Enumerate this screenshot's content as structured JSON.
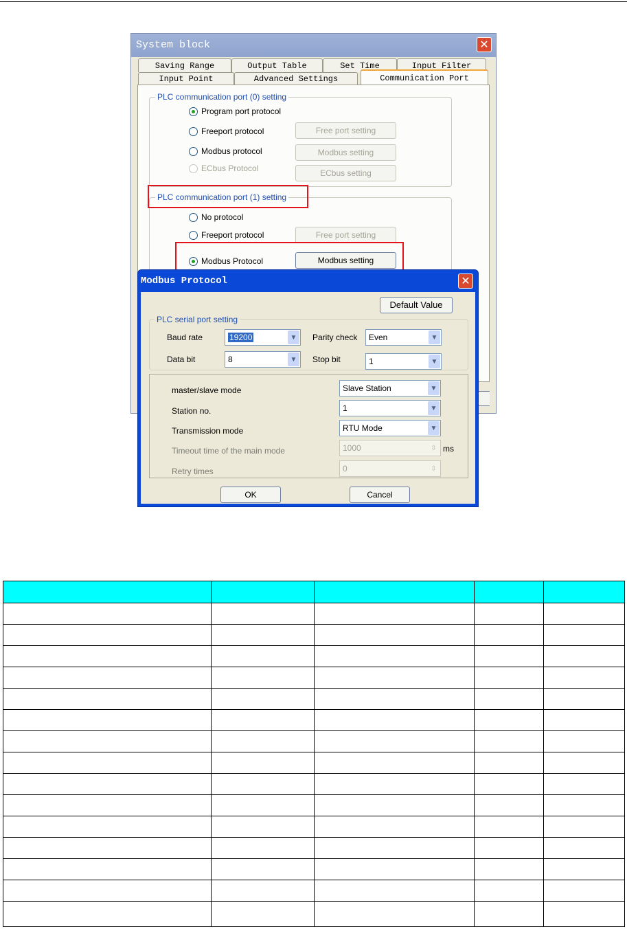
{
  "system_block": {
    "title": "System block",
    "tabs_row1": [
      "Saving Range",
      "Output Table",
      "Set Time",
      "Input Filter"
    ],
    "tabs_row2": [
      "Input Point",
      "Advanced Settings",
      "Communication Port"
    ],
    "port0": {
      "legend": "PLC communication port (0) setting",
      "options": [
        "Program port protocol",
        "Freeport protocol",
        "Modbus protocol",
        "ECbus Protocol"
      ],
      "buttons": [
        "Free port setting",
        "Modbus setting",
        "ECbus setting"
      ]
    },
    "port1": {
      "legend": "PLC communication port (1) setting",
      "options": [
        "No protocol",
        "Freeport protocol",
        "Modbus Protocol"
      ],
      "buttons": [
        "Free port setting",
        "Modbus setting"
      ]
    }
  },
  "modbus_dialog": {
    "title": "Modbus Protocol",
    "default_value_label": "Default Value",
    "serial_legend": "PLC serial port setting",
    "baud_rate_label": "Baud rate",
    "baud_rate_value": "19200",
    "parity_label": "Parity check",
    "parity_value": "Even",
    "data_bit_label": "Data bit",
    "data_bit_value": "8",
    "stop_bit_label": "Stop bit",
    "stop_bit_value": "1",
    "mode_label": "master/slave mode",
    "mode_value": "Slave Station",
    "station_label": "Station no.",
    "station_value": "1",
    "transmission_label": "Transmission mode",
    "transmission_value": "RTU Mode",
    "timeout_label": "Timeout time of the main mode",
    "timeout_value": "1000",
    "timeout_unit": "ms",
    "retry_label": "Retry times",
    "retry_value": "0",
    "ok_label": "OK",
    "cancel_label": "Cancel"
  },
  "colors": {
    "table_header": "#00ffff",
    "highlight_box": "#e3121b",
    "dialog_title_bar": "#0a49d8"
  }
}
